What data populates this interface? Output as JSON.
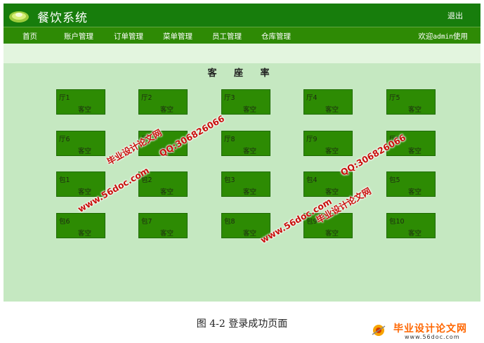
{
  "header": {
    "title": "餐饮系统",
    "logout_label": "退出"
  },
  "nav": {
    "items": [
      "首页",
      "账户管理",
      "订单管理",
      "菜单管理",
      "员工管理",
      "仓库管理"
    ],
    "welcome_prefix": "欢迎",
    "welcome_user": "admin",
    "welcome_suffix": "使用"
  },
  "content": {
    "title": "客 座 率"
  },
  "tables": [
    {
      "name": "厅1",
      "status": "客空"
    },
    {
      "name": "厅2",
      "status": "客空"
    },
    {
      "name": "厅3",
      "status": "客空"
    },
    {
      "name": "厅4",
      "status": "客空"
    },
    {
      "name": "厅5",
      "status": "客空"
    },
    {
      "name": "厅6",
      "status": "客空"
    },
    {
      "name": "厅7",
      "status": "客空"
    },
    {
      "name": "厅8",
      "status": "客空"
    },
    {
      "name": "厅9",
      "status": "客空"
    },
    {
      "name": "厅10",
      "status": "客空"
    },
    {
      "name": "包1",
      "status": "客空"
    },
    {
      "name": "包2",
      "status": "客空"
    },
    {
      "name": "包3",
      "status": "客空"
    },
    {
      "name": "包4",
      "status": "客空"
    },
    {
      "name": "包5",
      "status": "客空"
    },
    {
      "name": "包6",
      "status": "客空"
    },
    {
      "name": "包7",
      "status": "客空"
    },
    {
      "name": "包8",
      "status": "客空"
    },
    {
      "name": "包9",
      "status": "客空"
    },
    {
      "name": "包10",
      "status": "客空"
    }
  ],
  "caption": "图 4-2 登录成功页面",
  "watermarks": {
    "site_name": "毕业设计论文网",
    "url": "www.56doc.com",
    "qq": "QQ:306826066"
  },
  "brand": {
    "name": "毕业设计论文网",
    "url": "www.56doc.com"
  },
  "colors": {
    "header_bg": "#177d0c",
    "nav_bg": "#2e8a05",
    "content_bg": "#c5e8c1",
    "table_bg": "#2d8b03",
    "watermark": "#c8100c"
  }
}
